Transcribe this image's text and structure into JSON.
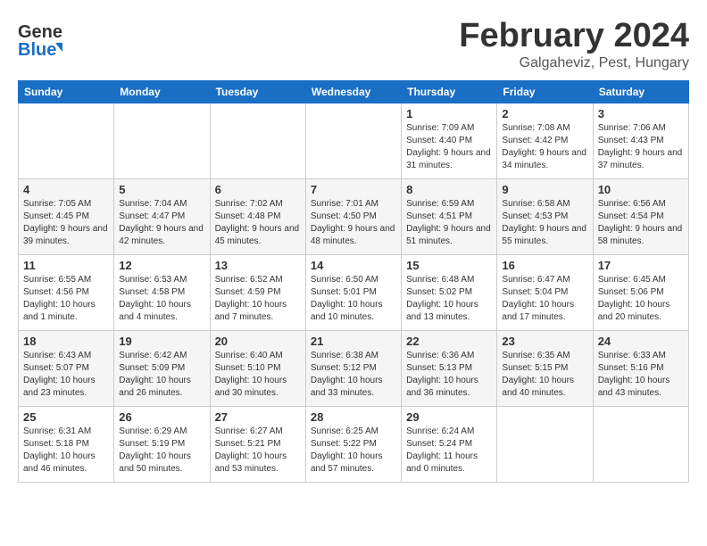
{
  "header": {
    "logo_line1": "General",
    "logo_line2": "Blue",
    "month": "February 2024",
    "location": "Galgaheviz, Pest, Hungary"
  },
  "days_of_week": [
    "Sunday",
    "Monday",
    "Tuesday",
    "Wednesday",
    "Thursday",
    "Friday",
    "Saturday"
  ],
  "weeks": [
    [
      {
        "day": "",
        "sunrise": "",
        "sunset": "",
        "daylight": ""
      },
      {
        "day": "",
        "sunrise": "",
        "sunset": "",
        "daylight": ""
      },
      {
        "day": "",
        "sunrise": "",
        "sunset": "",
        "daylight": ""
      },
      {
        "day": "",
        "sunrise": "",
        "sunset": "",
        "daylight": ""
      },
      {
        "day": "1",
        "sunrise": "Sunrise: 7:09 AM",
        "sunset": "Sunset: 4:40 PM",
        "daylight": "Daylight: 9 hours and 31 minutes."
      },
      {
        "day": "2",
        "sunrise": "Sunrise: 7:08 AM",
        "sunset": "Sunset: 4:42 PM",
        "daylight": "Daylight: 9 hours and 34 minutes."
      },
      {
        "day": "3",
        "sunrise": "Sunrise: 7:06 AM",
        "sunset": "Sunset: 4:43 PM",
        "daylight": "Daylight: 9 hours and 37 minutes."
      }
    ],
    [
      {
        "day": "4",
        "sunrise": "Sunrise: 7:05 AM",
        "sunset": "Sunset: 4:45 PM",
        "daylight": "Daylight: 9 hours and 39 minutes."
      },
      {
        "day": "5",
        "sunrise": "Sunrise: 7:04 AM",
        "sunset": "Sunset: 4:47 PM",
        "daylight": "Daylight: 9 hours and 42 minutes."
      },
      {
        "day": "6",
        "sunrise": "Sunrise: 7:02 AM",
        "sunset": "Sunset: 4:48 PM",
        "daylight": "Daylight: 9 hours and 45 minutes."
      },
      {
        "day": "7",
        "sunrise": "Sunrise: 7:01 AM",
        "sunset": "Sunset: 4:50 PM",
        "daylight": "Daylight: 9 hours and 48 minutes."
      },
      {
        "day": "8",
        "sunrise": "Sunrise: 6:59 AM",
        "sunset": "Sunset: 4:51 PM",
        "daylight": "Daylight: 9 hours and 51 minutes."
      },
      {
        "day": "9",
        "sunrise": "Sunrise: 6:58 AM",
        "sunset": "Sunset: 4:53 PM",
        "daylight": "Daylight: 9 hours and 55 minutes."
      },
      {
        "day": "10",
        "sunrise": "Sunrise: 6:56 AM",
        "sunset": "Sunset: 4:54 PM",
        "daylight": "Daylight: 9 hours and 58 minutes."
      }
    ],
    [
      {
        "day": "11",
        "sunrise": "Sunrise: 6:55 AM",
        "sunset": "Sunset: 4:56 PM",
        "daylight": "Daylight: 10 hours and 1 minute."
      },
      {
        "day": "12",
        "sunrise": "Sunrise: 6:53 AM",
        "sunset": "Sunset: 4:58 PM",
        "daylight": "Daylight: 10 hours and 4 minutes."
      },
      {
        "day": "13",
        "sunrise": "Sunrise: 6:52 AM",
        "sunset": "Sunset: 4:59 PM",
        "daylight": "Daylight: 10 hours and 7 minutes."
      },
      {
        "day": "14",
        "sunrise": "Sunrise: 6:50 AM",
        "sunset": "Sunset: 5:01 PM",
        "daylight": "Daylight: 10 hours and 10 minutes."
      },
      {
        "day": "15",
        "sunrise": "Sunrise: 6:48 AM",
        "sunset": "Sunset: 5:02 PM",
        "daylight": "Daylight: 10 hours and 13 minutes."
      },
      {
        "day": "16",
        "sunrise": "Sunrise: 6:47 AM",
        "sunset": "Sunset: 5:04 PM",
        "daylight": "Daylight: 10 hours and 17 minutes."
      },
      {
        "day": "17",
        "sunrise": "Sunrise: 6:45 AM",
        "sunset": "Sunset: 5:06 PM",
        "daylight": "Daylight: 10 hours and 20 minutes."
      }
    ],
    [
      {
        "day": "18",
        "sunrise": "Sunrise: 6:43 AM",
        "sunset": "Sunset: 5:07 PM",
        "daylight": "Daylight: 10 hours and 23 minutes."
      },
      {
        "day": "19",
        "sunrise": "Sunrise: 6:42 AM",
        "sunset": "Sunset: 5:09 PM",
        "daylight": "Daylight: 10 hours and 26 minutes."
      },
      {
        "day": "20",
        "sunrise": "Sunrise: 6:40 AM",
        "sunset": "Sunset: 5:10 PM",
        "daylight": "Daylight: 10 hours and 30 minutes."
      },
      {
        "day": "21",
        "sunrise": "Sunrise: 6:38 AM",
        "sunset": "Sunset: 5:12 PM",
        "daylight": "Daylight: 10 hours and 33 minutes."
      },
      {
        "day": "22",
        "sunrise": "Sunrise: 6:36 AM",
        "sunset": "Sunset: 5:13 PM",
        "daylight": "Daylight: 10 hours and 36 minutes."
      },
      {
        "day": "23",
        "sunrise": "Sunrise: 6:35 AM",
        "sunset": "Sunset: 5:15 PM",
        "daylight": "Daylight: 10 hours and 40 minutes."
      },
      {
        "day": "24",
        "sunrise": "Sunrise: 6:33 AM",
        "sunset": "Sunset: 5:16 PM",
        "daylight": "Daylight: 10 hours and 43 minutes."
      }
    ],
    [
      {
        "day": "25",
        "sunrise": "Sunrise: 6:31 AM",
        "sunset": "Sunset: 5:18 PM",
        "daylight": "Daylight: 10 hours and 46 minutes."
      },
      {
        "day": "26",
        "sunrise": "Sunrise: 6:29 AM",
        "sunset": "Sunset: 5:19 PM",
        "daylight": "Daylight: 10 hours and 50 minutes."
      },
      {
        "day": "27",
        "sunrise": "Sunrise: 6:27 AM",
        "sunset": "Sunset: 5:21 PM",
        "daylight": "Daylight: 10 hours and 53 minutes."
      },
      {
        "day": "28",
        "sunrise": "Sunrise: 6:25 AM",
        "sunset": "Sunset: 5:22 PM",
        "daylight": "Daylight: 10 hours and 57 minutes."
      },
      {
        "day": "29",
        "sunrise": "Sunrise: 6:24 AM",
        "sunset": "Sunset: 5:24 PM",
        "daylight": "Daylight: 11 hours and 0 minutes."
      },
      {
        "day": "",
        "sunrise": "",
        "sunset": "",
        "daylight": ""
      },
      {
        "day": "",
        "sunrise": "",
        "sunset": "",
        "daylight": ""
      }
    ]
  ]
}
